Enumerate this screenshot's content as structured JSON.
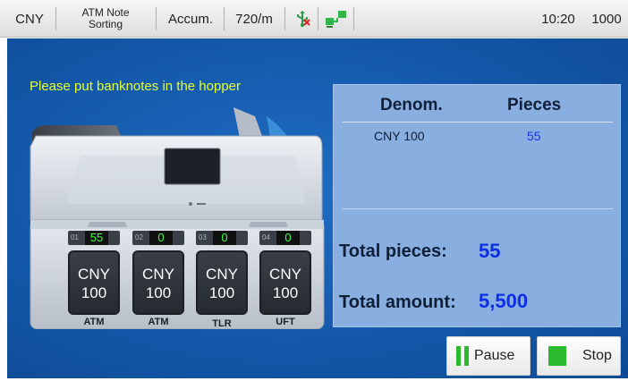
{
  "statusbar": {
    "currency": "CNY",
    "mode_line1": "ATM Note",
    "mode_line2": "Sorting",
    "count_mode": "Accum.",
    "speed": "720/m",
    "usb_icon": "usb-icon",
    "network_icon": "network-icon",
    "time": "10:20",
    "batch": "1000"
  },
  "main": {
    "prompt": "Please put banknotes in the hopper"
  },
  "machine": {
    "pockets": [
      {
        "num": "01",
        "count": "55",
        "currency": "CNY",
        "denom": "100",
        "label": "ATM"
      },
      {
        "num": "02",
        "count": "0",
        "currency": "CNY",
        "denom": "100",
        "label": "ATM"
      },
      {
        "num": "03",
        "count": "0",
        "currency": "CNY",
        "denom": "100",
        "label": "TLR"
      },
      {
        "num": "04",
        "count": "0",
        "currency": "CNY",
        "denom": "100",
        "label": "UFT"
      }
    ]
  },
  "table": {
    "col_denom": "Denom.",
    "col_pieces": "Pieces",
    "rows": [
      {
        "denom": "CNY 100",
        "pieces": "55"
      }
    ]
  },
  "totals": {
    "pieces_label": "Total pieces:",
    "pieces_value": "55",
    "amount_label": "Total amount:",
    "amount_value": "5,500"
  },
  "buttons": {
    "pause": "Pause",
    "stop": "Stop"
  },
  "colors": {
    "panel_blue": "#1459ab",
    "prompt_yellow": "#e8ff2e",
    "accent_green": "#2db92d",
    "count_green": "#39ff3c",
    "value_blue": "#0c2ee8"
  }
}
